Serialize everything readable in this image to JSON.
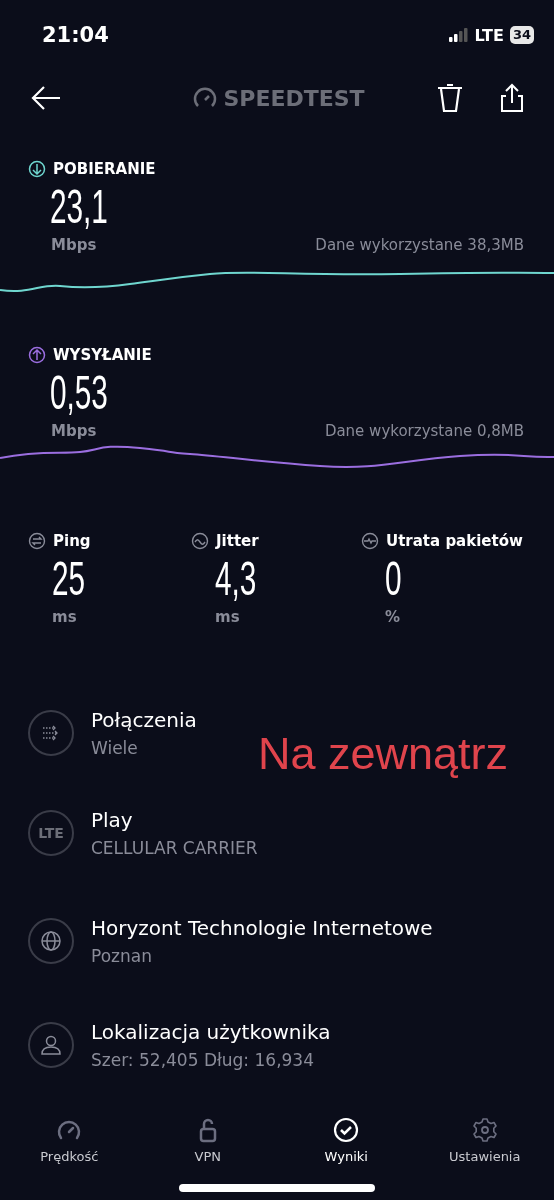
{
  "status_bar": {
    "time": "21:04",
    "network": "LTE",
    "battery": "34"
  },
  "header": {
    "title": "SPEEDTEST"
  },
  "speeds": [
    {
      "kind": "download",
      "label": "POBIERANIE",
      "value": "23,1",
      "unit": "Mbps",
      "data_used": "Dane wykorzystane 38,3MB",
      "color": "#6fd6cf"
    },
    {
      "kind": "upload",
      "label": "WYSYŁANIE",
      "value": "0,53",
      "unit": "Mbps",
      "data_used": "Dane wykorzystane 0,8MB",
      "color": "#9b6ee0"
    }
  ],
  "metrics": [
    {
      "kind": "ping",
      "label": "Ping",
      "value": "25",
      "unit": "ms"
    },
    {
      "kind": "jitter",
      "label": "Jitter",
      "value": "4,3",
      "unit": "ms"
    },
    {
      "kind": "loss",
      "label": "Utrata pakietów",
      "value": "0",
      "unit": "%"
    }
  ],
  "details": [
    {
      "kind": "connections",
      "title": "Połączenia",
      "subtitle": "Wiele"
    },
    {
      "kind": "carrier",
      "title": "Play",
      "subtitle": "CELLULAR CARRIER",
      "icon_text": "LTE"
    },
    {
      "kind": "server",
      "title": "Horyzont Technologie Internetowe",
      "subtitle": "Poznan"
    },
    {
      "kind": "location",
      "title": "Lokalizacja użytkownika",
      "subtitle": "Szer: 52,405  Dług: 16,934"
    }
  ],
  "overlay_note": "Na zewnątrz",
  "tabs": [
    {
      "kind": "speed",
      "label": "Prędkość",
      "selected": false
    },
    {
      "kind": "vpn",
      "label": "VPN",
      "selected": false
    },
    {
      "kind": "results",
      "label": "Wyniki",
      "selected": true
    },
    {
      "kind": "settings",
      "label": "Ustawienia",
      "selected": false
    }
  ]
}
